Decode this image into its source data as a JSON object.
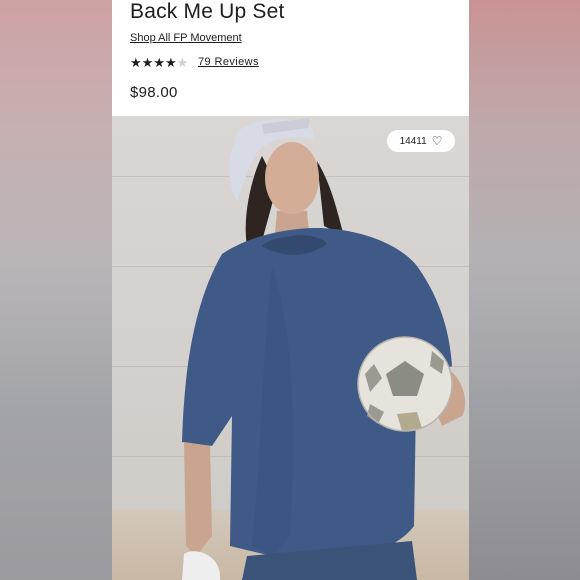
{
  "product": {
    "title": "Back Me Up Set",
    "shop_link": "Shop All FP Movement",
    "rating_stars": 4,
    "rating_max": 5,
    "reviews_label": "79 Reviews",
    "price": "$98.00"
  },
  "photo": {
    "like_count": "14411",
    "like_icon": "heart-outline-icon",
    "description_subject": "model in navy oversized tee holding soccer ball"
  },
  "colors": {
    "shirt": "#3f5a86",
    "cap": "#d8dae6",
    "background_wall": "#d9d6d3"
  }
}
